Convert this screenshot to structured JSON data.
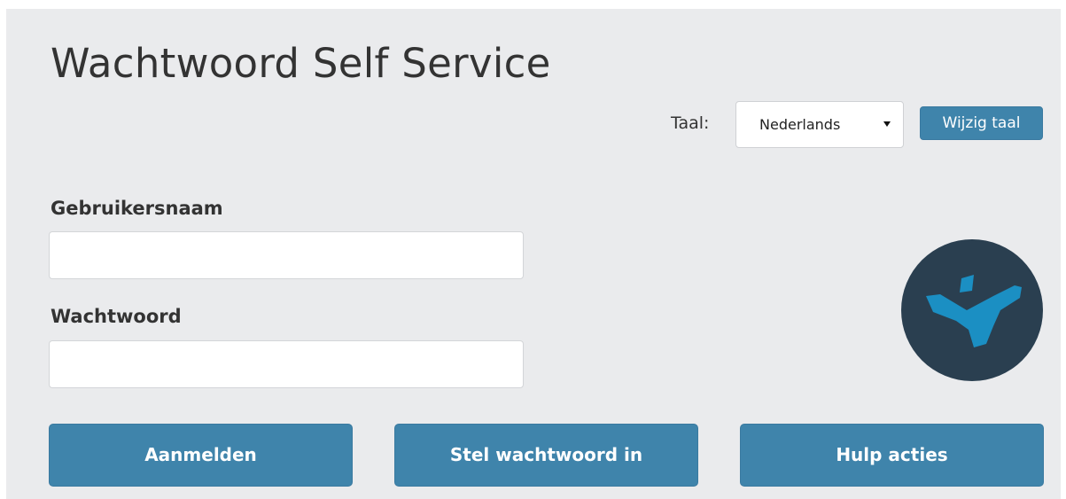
{
  "title": "Wachtwoord Self Service",
  "language": {
    "label": "Taal:",
    "selected": "Nederlands",
    "change_button": "Wijzig taal"
  },
  "form": {
    "username_label": "Gebruikersnaam",
    "username_value": "",
    "password_label": "Wachtwoord",
    "password_value": ""
  },
  "actions": {
    "login": "Aanmelden",
    "set_password": "Stel wachtwoord in",
    "help": "Hulp acties"
  },
  "logo": {
    "icon": "brand-logo-icon",
    "background_color": "#2a3f50",
    "mark_color": "#1b8fc3"
  },
  "colors": {
    "accent": "#3f84ab",
    "panel_background": "#eaebed"
  }
}
